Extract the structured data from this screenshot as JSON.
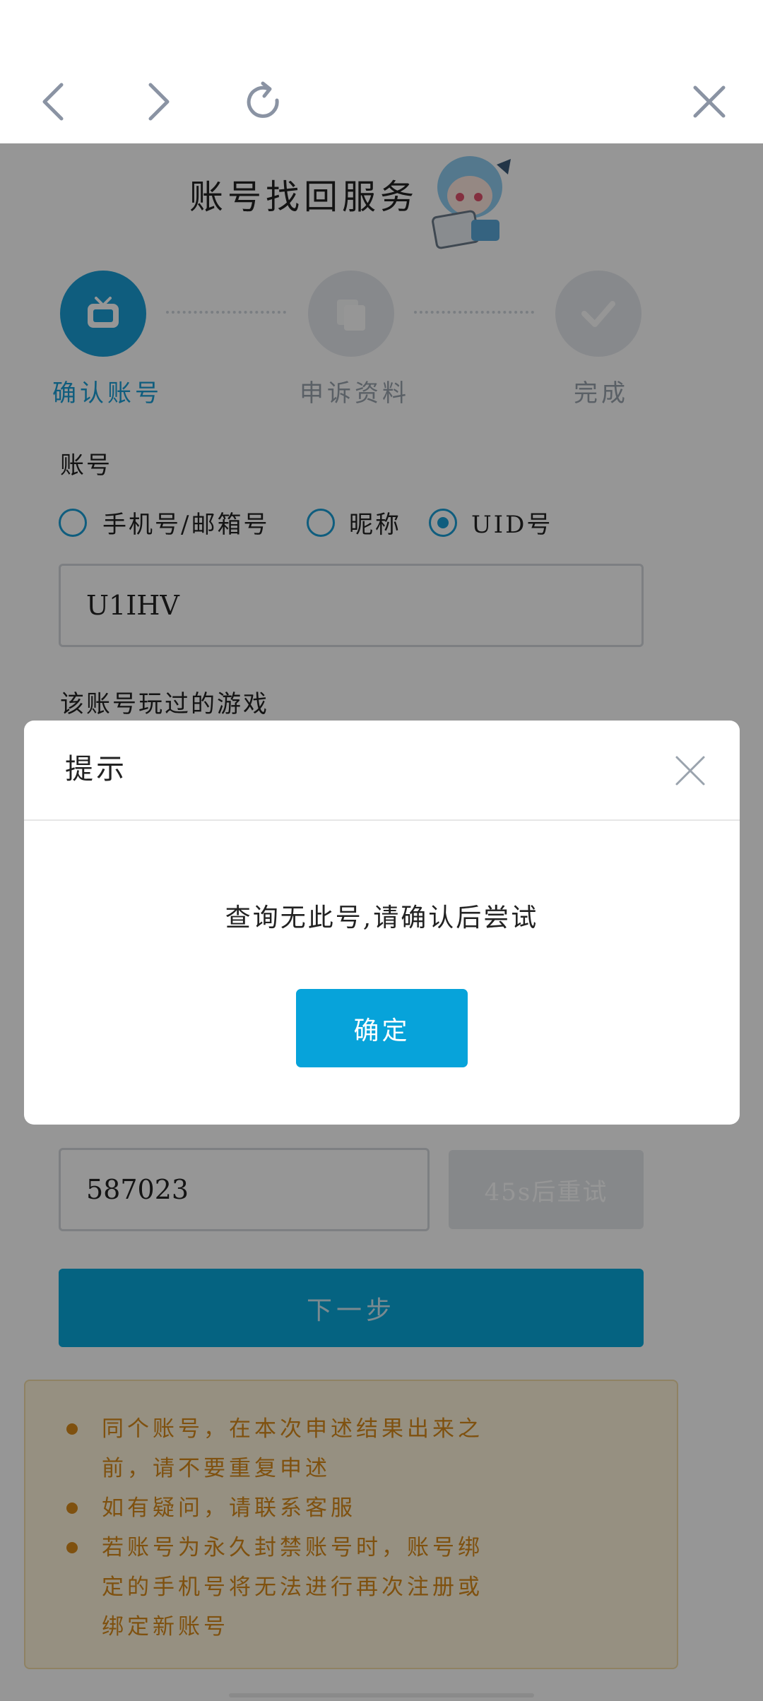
{
  "page": {
    "title": "账号找回服务"
  },
  "steps": [
    {
      "label": "确认账号",
      "active": true
    },
    {
      "label": "申诉资料",
      "active": false
    },
    {
      "label": "完成",
      "active": false
    }
  ],
  "account": {
    "label": "账号",
    "options": [
      "手机号/邮箱号",
      "昵称",
      "UID号"
    ],
    "selected": "UID号",
    "value": "U1IHV"
  },
  "games": {
    "label": "该账号玩过的游戏"
  },
  "code": {
    "value": "587023",
    "retry_label": "45s后重试"
  },
  "next_label": "下一步",
  "notice": [
    "同个账号，在本次申述结果出来之前，请不要重复申述",
    "如有疑问，请联系客服",
    "若账号为永久封禁账号时，账号绑定的手机号将无法进行再次注册或绑定新账号"
  ],
  "modal": {
    "title": "提示",
    "message": "查询无此号,请确认后尝试",
    "confirm": "确定"
  },
  "colors": {
    "accent": "#0aa8dc",
    "notice_text": "#d88a1b",
    "notice_bg": "#fff5dc"
  },
  "icons": [
    "back-icon",
    "forward-icon",
    "refresh-icon",
    "close-icon",
    "tv-icon",
    "documents-icon",
    "checkmark-icon"
  ]
}
